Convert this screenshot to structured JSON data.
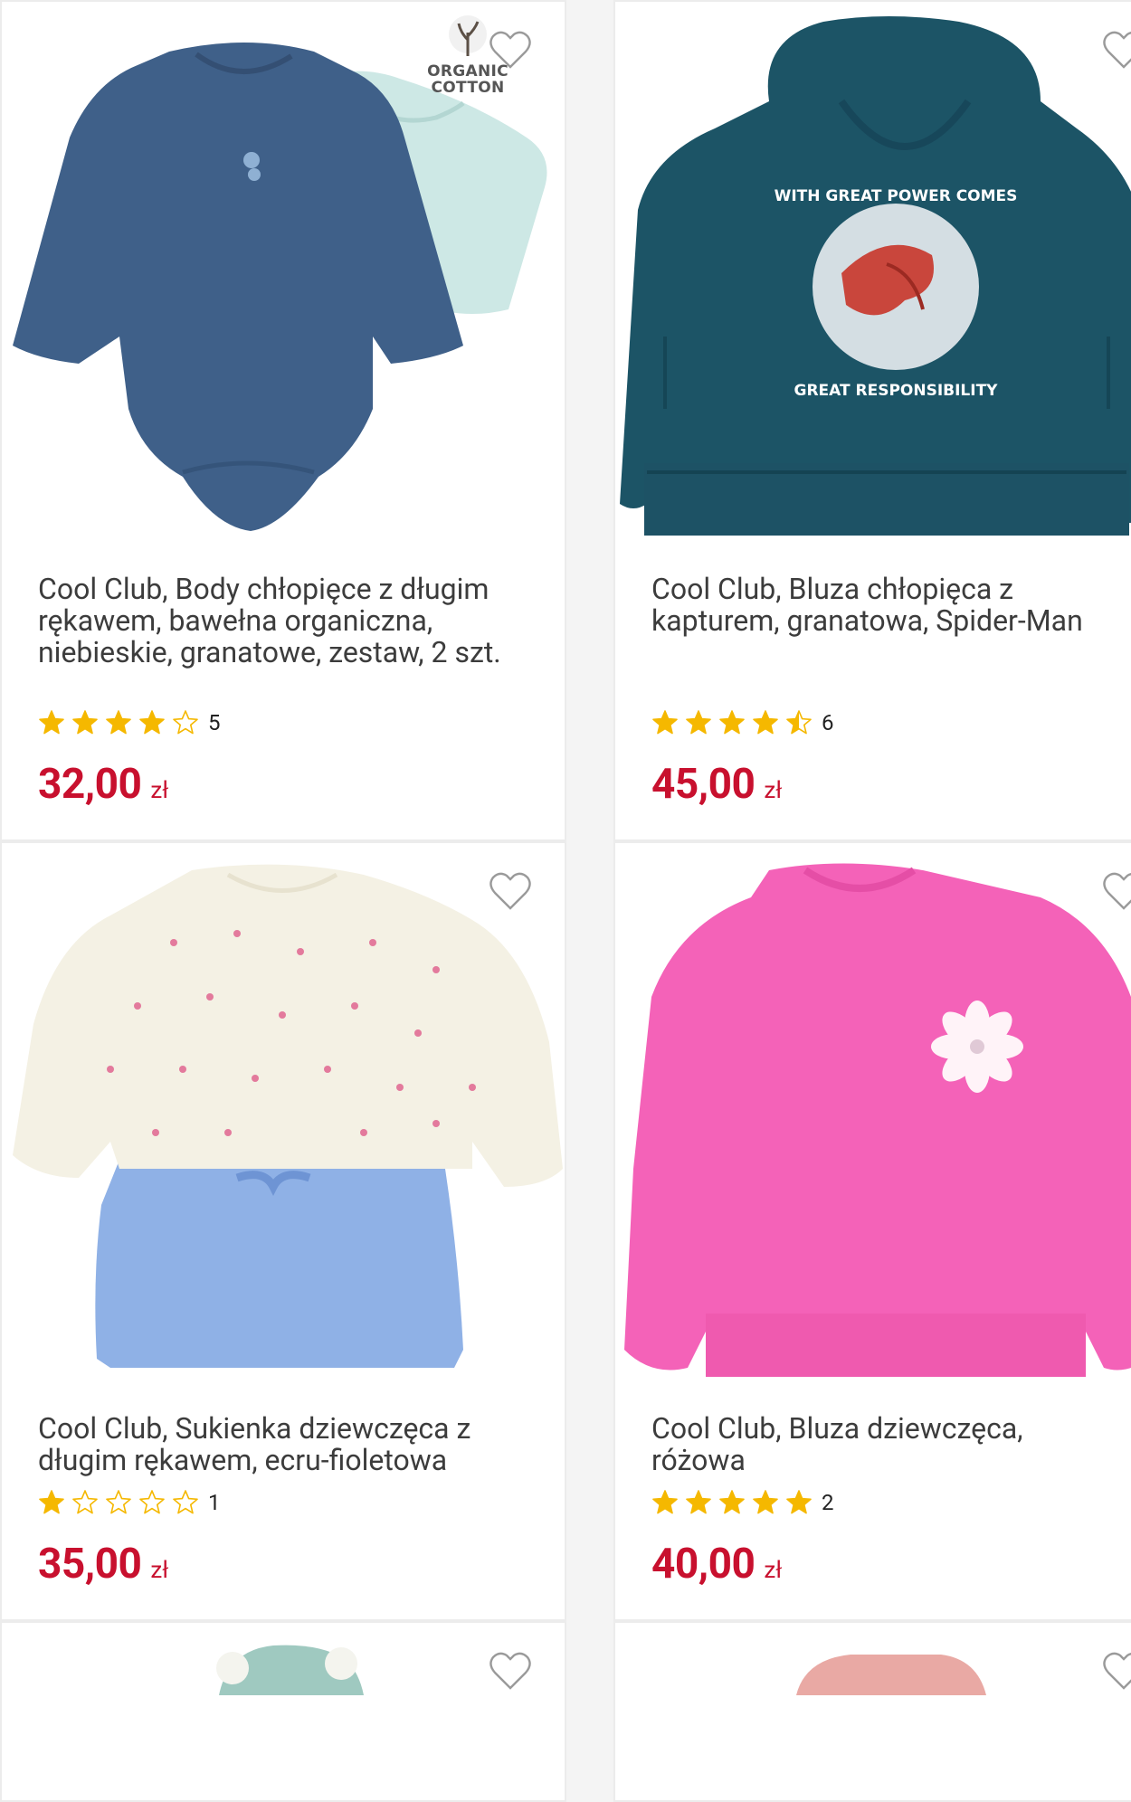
{
  "products": [
    {
      "title": "Cool Club, Body chłopięce z długim rękawem, bawełna organiczna, niebieskie, granatowe, zestaw, 2 szt.",
      "rating": 4,
      "reviews": "5",
      "price": "32,00",
      "currency": "zł",
      "badge": [
        "ORGANIC",
        "COTTON"
      ],
      "image": "navy-and-mint-baby-bodysuits"
    },
    {
      "title": "Cool Club, Bluza chłopięca z kapturem, granatowa, Spider-Man",
      "rating": 4.5,
      "reviews": "6",
      "price": "45,00",
      "currency": "zł",
      "image": "teal-hoodie-spider-man-print",
      "print_text": [
        "WITH GREAT POWER COMES",
        "GREAT RESPONSIBILITY"
      ]
    },
    {
      "title": "Cool Club, Sukienka dziewczęca z długim rękawem, ecru-fioletowa",
      "rating": 1,
      "reviews": "1",
      "price": "35,00",
      "currency": "zł",
      "image": "ecru-and-blue-girls-dress"
    },
    {
      "title": "Cool Club, Bluza dziewczęca, różowa",
      "rating": 5,
      "reviews": "2",
      "price": "40,00",
      "currency": "zł",
      "image": "pink-sweatshirt-flower"
    }
  ],
  "colors": {
    "price": "#c8102e",
    "star": "#f5b800",
    "title": "#3c3c3c"
  },
  "icons": {
    "wishlist": "heart-outline-icon",
    "rating": "star-icon"
  }
}
